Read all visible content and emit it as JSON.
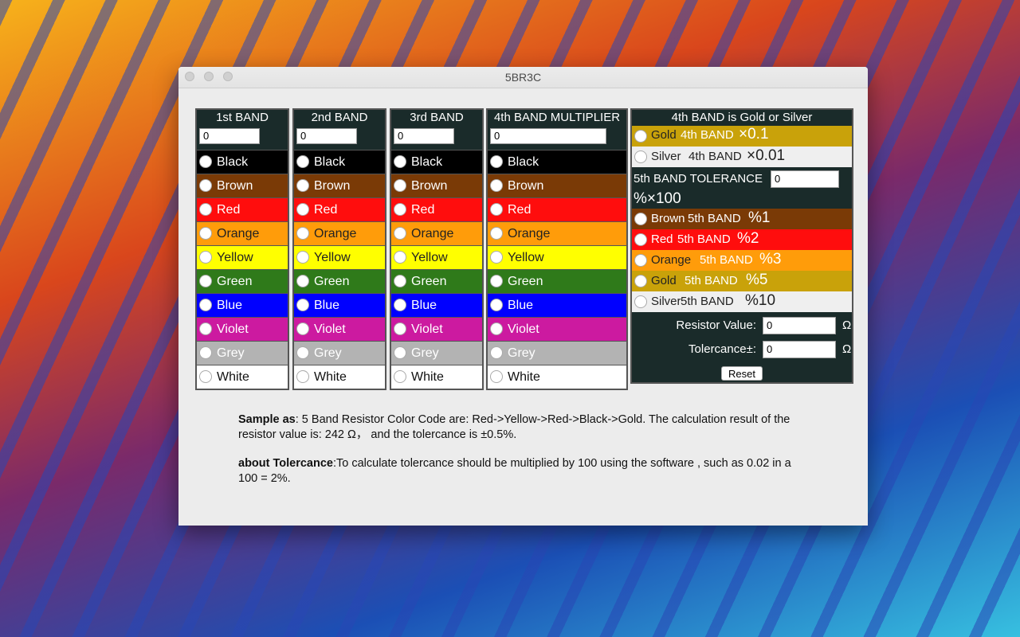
{
  "window": {
    "title": "5BR3C"
  },
  "band_colors": [
    {
      "name": "Black",
      "bg": "#000000",
      "fg": "#ffffff"
    },
    {
      "name": "Brown",
      "bg": "#7a3a06",
      "fg": "#ffffff"
    },
    {
      "name": "Red",
      "bg": "#ff0d0d",
      "fg": "#ffffff"
    },
    {
      "name": "Orange",
      "bg": "#ff9c0a",
      "fg": "#222222"
    },
    {
      "name": "Yellow",
      "bg": "#ffff00",
      "fg": "#222222"
    },
    {
      "name": "Green",
      "bg": "#2f7a1a",
      "fg": "#ffffff"
    },
    {
      "name": "Blue",
      "bg": "#0000ff",
      "fg": "#ffffff"
    },
    {
      "name": "Violet",
      "bg": "#cc1aa0",
      "fg": "#ffffff"
    },
    {
      "name": "Grey",
      "bg": "#b3b3b3",
      "fg": "#ffffff"
    },
    {
      "name": "White",
      "bg": "#ffffff",
      "fg": "#111111"
    }
  ],
  "bands": [
    {
      "header": "1st BAND",
      "value": "0"
    },
    {
      "header": "2nd BAND",
      "value": "0"
    },
    {
      "header": "3rd BAND",
      "value": "0"
    },
    {
      "header": "4th BAND MULTIPLIER",
      "value": "0"
    }
  ],
  "side_panel": {
    "header": "4th BAND is Gold or Silver",
    "gold_label": "Gold",
    "gold_band": "4th BAND",
    "gold_mult": "×0.1",
    "silver_label": "Silver",
    "silver_band": "4th BAND",
    "silver_mult": "×0.01",
    "tolerance_label": "5th BAND TOLERANCE",
    "tolerance_value": "0",
    "tolerance_note": "%×100",
    "tolerances": [
      {
        "label": "Brown",
        "band": "5th BAND",
        "pct": "%1",
        "bg": "#7a3a06",
        "fg": "#ffffff",
        "bandfg": "#ffffff"
      },
      {
        "label": "Red",
        "band": "5th BAND",
        "pct": "%2",
        "bg": "#ff0d0d",
        "fg": "#ffffff",
        "bandfg": "#ffffff"
      },
      {
        "label": "Orange",
        "band": "5th BAND",
        "pct": "%3",
        "bg": "#ff9c0a",
        "fg": "#222222",
        "bandfg": "#ffffff"
      },
      {
        "label": "Gold",
        "band": "5th BAND",
        "pct": "%5",
        "bg": "#c9a20a",
        "fg": "#222222",
        "bandfg": "#ffffff"
      },
      {
        "label": "Silver",
        "band": "5th BAND",
        "pct": "%10",
        "bg": "#efefef",
        "fg": "#222222",
        "bandfg": "#222222"
      }
    ],
    "resistor_label": "Resistor Value:",
    "resistor_value": "0",
    "resistor_unit": "Ω",
    "tolercance_label": "Tolercance±:",
    "tolercance_value": "0",
    "tolercance_unit": "Ω",
    "reset_label": "Reset"
  },
  "info": {
    "sample_title": "Sample as",
    "sample_text": ": 5 Band Resistor Color Code are: Red->Yellow->Red->Black->Gold. The calculation result of the resistor value is: 242 Ω，  and the tolercance is ±0.5%.",
    "about_title": "about Tolercance",
    "about_text": ":To calculate tolercance should be multiplied by 100 using the software , such as 0.02 in a 100 = 2%."
  }
}
